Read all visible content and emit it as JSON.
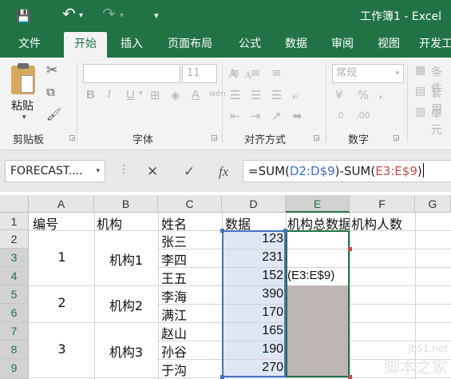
{
  "titlebar": {
    "save_icon": "💾",
    "undo_icon": "↶",
    "redo_icon": "↷",
    "qat_icon": "▾",
    "dropdown_glyph": "▾",
    "title": "工作簿1 - Excel"
  },
  "tabs": [
    "文件",
    "开始",
    "插入",
    "页面布局",
    "公式",
    "数据",
    "审阅",
    "视图",
    "开发工"
  ],
  "ribbon": {
    "paste_label": "粘贴",
    "clipboard_label": "剪贴板",
    "font_label": "字体",
    "font_size": "11",
    "bold": "B",
    "italic": "I",
    "underline": "U",
    "grow": "A",
    "shrink": "A",
    "font_color": "A",
    "style_a": "wén",
    "align_label": "对齐方式",
    "number_label": "数字",
    "number_format": "常规",
    "percent": "%",
    "comma": ",",
    "currency": "¥",
    "dec_inc": ".0",
    "dec_dec": ".00",
    "cond_format": "条件",
    "table_format": "套用",
    "cell_styles": "单元"
  },
  "formula_bar": {
    "name_box": "FORECAST....",
    "cancel": "✕",
    "enter": "✓",
    "fx": "fx",
    "formula_prefix": "=SUM(",
    "ref1": "D2:D$9",
    "formula_mid": ")-SUM(",
    "ref2": "E3:E$9",
    "formula_suffix": ")"
  },
  "sheet": {
    "columns": [
      "A",
      "B",
      "C",
      "D",
      "E",
      "F",
      "G"
    ],
    "rows": [
      "1",
      "2",
      "3",
      "4",
      "5",
      "6",
      "7",
      "8",
      "9"
    ],
    "headers": {
      "a1": "编号",
      "b1": "机构",
      "c1": "姓名",
      "d1": "数据",
      "e1": "机构总数据",
      "f1": "机构人数"
    },
    "groups": [
      {
        "no": "1",
        "org": "机构1"
      },
      {
        "no": "2",
        "org": "机构2"
      },
      {
        "no": "3",
        "org": "机构3"
      }
    ],
    "names": [
      "张三",
      "李四",
      "王五",
      "李海",
      "满江",
      "赵山",
      "孙谷",
      "于沟"
    ],
    "values": [
      "123",
      "231",
      "152",
      "390",
      "170",
      "165",
      "190",
      "270"
    ],
    "edit_cell": "(E3:E$9)"
  },
  "watermark": {
    "site": "jb51.net",
    "brand": "脚本之家"
  }
}
